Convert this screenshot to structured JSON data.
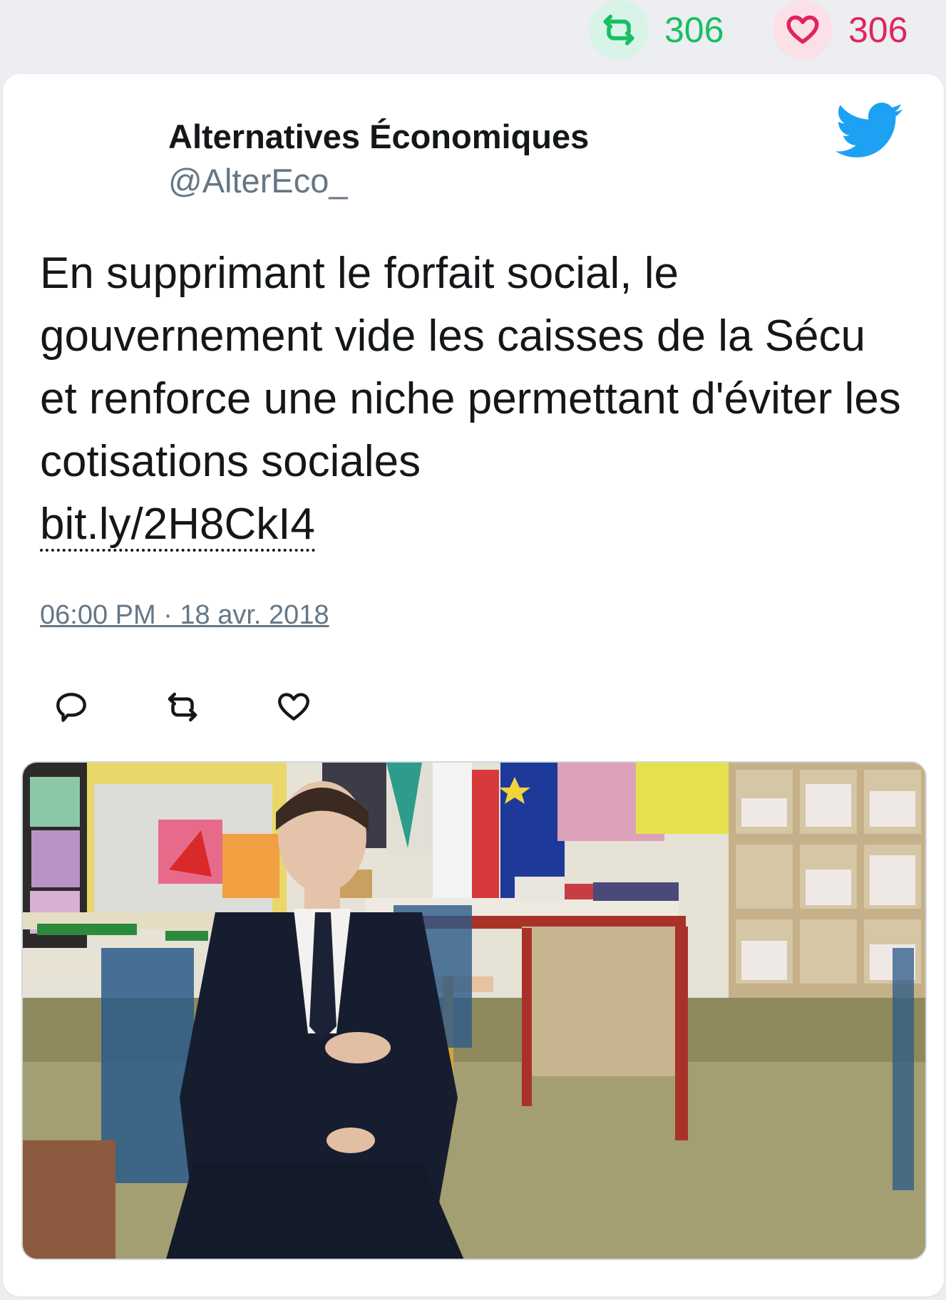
{
  "stats": {
    "retweets": "306",
    "likes": "306"
  },
  "tweet": {
    "author_name": "Alternatives Économiques",
    "author_handle": "@AlterEco_",
    "text": "En supprimant le forfait social, le gouvernement vide les caisses de la Sécu et renforce une niche permettant d'éviter les cotisations sociales",
    "link": "bit.ly/2H8CkI4",
    "timestamp": "06:00 PM · 18 avr. 2018"
  },
  "icons": {
    "retweet": "retweet-icon",
    "like": "heart-icon",
    "reply": "reply-icon",
    "brand": "twitter-bird-icon"
  },
  "colors": {
    "retweet": "#17bf63",
    "like": "#e0245e",
    "twitter_blue": "#1da1f2",
    "muted": "#657786"
  },
  "media": {
    "kind": "photo"
  }
}
